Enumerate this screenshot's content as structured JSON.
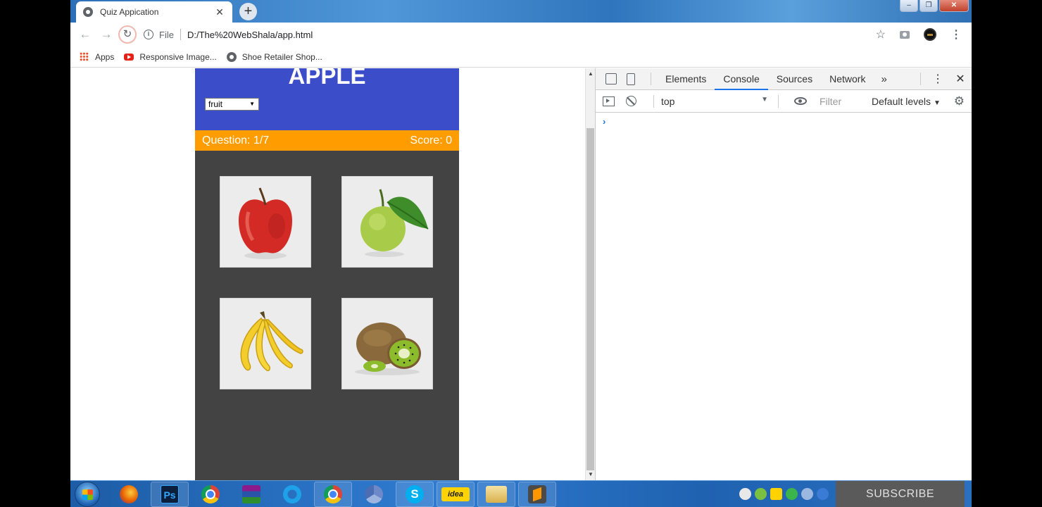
{
  "browser": {
    "tab_title": "Quiz Appication",
    "tab_close": "✕",
    "new_tab": "+",
    "window_controls": {
      "minimize": "–",
      "maximize": "❐",
      "close": "✕"
    },
    "address": {
      "scheme": "File",
      "url": "D:/The%20WebShala/app.html"
    },
    "bookmarks": [
      {
        "label": "Apps",
        "icon": "apps-grid-icon"
      },
      {
        "label": "Responsive Image...",
        "icon": "youtube-icon"
      },
      {
        "label": "Shoe Retailer Shop...",
        "icon": "globe-icon"
      }
    ]
  },
  "quiz": {
    "word": "APPLE",
    "category": {
      "selected": "fruit"
    },
    "question_label": "Question: 1/7",
    "score_label": "Score: 0",
    "options": [
      {
        "name": "apple"
      },
      {
        "name": "guava"
      },
      {
        "name": "banana"
      },
      {
        "name": "kiwi"
      }
    ],
    "header_color": "#3b4dc9",
    "status_color": "#ff9d00",
    "body_color": "#434343"
  },
  "devtools": {
    "tabs": [
      "Elements",
      "Console",
      "Sources",
      "Network"
    ],
    "active_tab": "Console",
    "more_tabs": "»",
    "context": "top",
    "filter_placeholder": "Filter",
    "levels": "Default levels",
    "prompt": "›"
  },
  "taskbar": {
    "apps": [
      "firefox",
      "photoshop",
      "chrome",
      "winrar",
      "internet-explorer",
      "chrome",
      "chrome-canary",
      "skype",
      "idea",
      "file-explorer",
      "sublime-text"
    ],
    "ps_label": "Ps",
    "skype_label": "S",
    "idea_label": "idea",
    "overlay": "SUBSCRIBE"
  }
}
